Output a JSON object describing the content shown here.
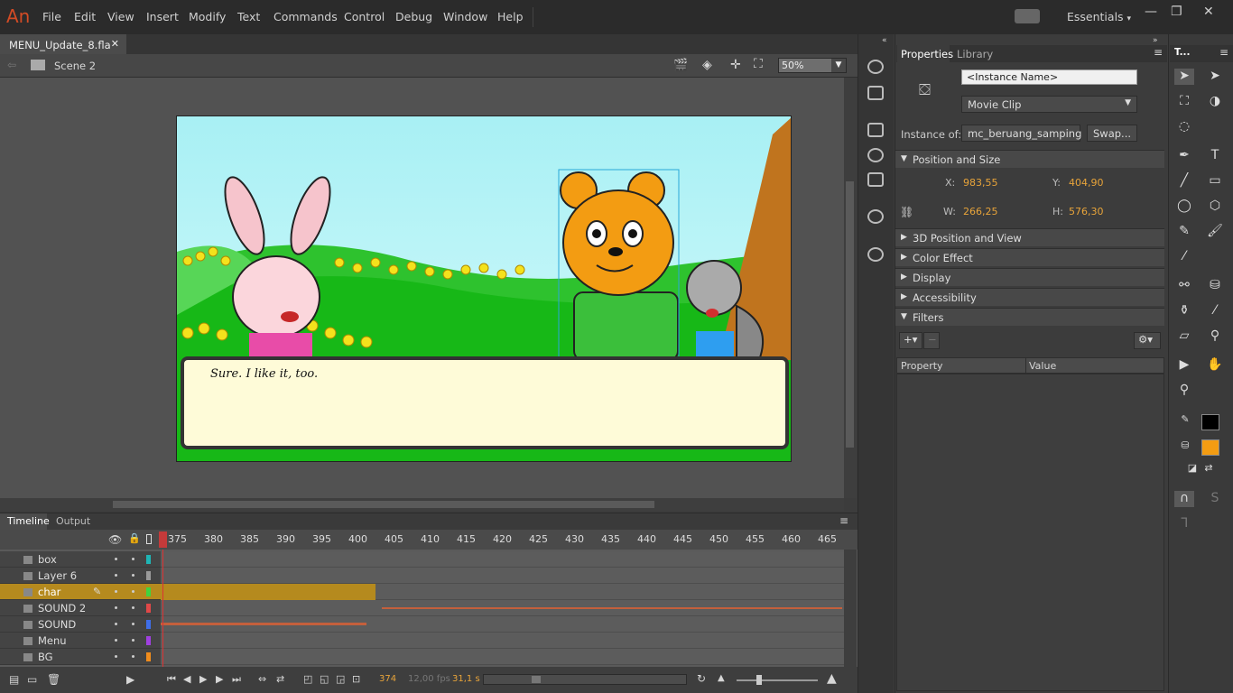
{
  "app": {
    "logo": "An",
    "workspace": "Essentials"
  },
  "menu": [
    "File",
    "Edit",
    "View",
    "Insert",
    "Modify",
    "Text",
    "Commands",
    "Control",
    "Debug",
    "Window",
    "Help"
  ],
  "document": {
    "tab": "MENU_Update_8.fla",
    "scene": "Scene 2",
    "zoom": "50%"
  },
  "stage": {
    "dialog_text": "Sure. I like it, too."
  },
  "timeline": {
    "tabs": [
      "Timeline",
      "Output"
    ],
    "ruler": [
      "375",
      "380",
      "385",
      "390",
      "395",
      "400",
      "405",
      "410",
      "415",
      "420",
      "425",
      "430",
      "435",
      "440",
      "445",
      "450",
      "455",
      "460",
      "465"
    ],
    "layers": [
      {
        "name": "box",
        "color": "#1fb5b5"
      },
      {
        "name": "Layer 6",
        "color": "#9a9a9a"
      },
      {
        "name": "char",
        "color": "#3fd43f"
      },
      {
        "name": "SOUND 2",
        "color": "#e04848"
      },
      {
        "name": "SOUND",
        "color": "#3f6ee8"
      },
      {
        "name": "Menu",
        "color": "#a040e0"
      },
      {
        "name": "BG",
        "color": "#f08c1c"
      }
    ],
    "current_frame": "374",
    "fps": "12,00 fps",
    "time": "31,1 s"
  },
  "properties": {
    "tabs": [
      "Properties",
      "Library"
    ],
    "instance_name_placeholder": "<Instance Name>",
    "symbol_type": "Movie Clip",
    "instance_of_label": "Instance of:",
    "instance_of": "mc_beruang_samping",
    "swap_label": "Swap...",
    "sections": [
      "Position and Size",
      "3D Position and View",
      "Color Effect",
      "Display",
      "Accessibility",
      "Filters"
    ],
    "x_label": "X:",
    "x": "983,55",
    "y_label": "Y:",
    "y": "404,90",
    "w_label": "W:",
    "w": "266,25",
    "h_label": "H:",
    "h": "576,30",
    "filter_cols": [
      "Property",
      "Value"
    ]
  },
  "tools_panel_title": "T...",
  "colors": {
    "stroke": "#000000",
    "fill": "#f39c12"
  }
}
